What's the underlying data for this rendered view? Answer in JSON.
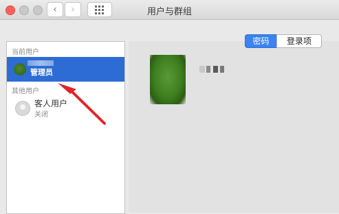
{
  "window": {
    "title": "用户与群组"
  },
  "toolbar": {
    "back_icon": "chevron-left-icon",
    "forward_icon": "chevron-right-icon",
    "grid_icon": "grid-icon"
  },
  "sidebar": {
    "current_section": "当前用户",
    "current_user": {
      "label": "管理员"
    },
    "other_section": "其他用户",
    "guest": {
      "name": "客人用户",
      "status": "关闭"
    }
  },
  "tabs": {
    "password": "密码",
    "login_items": "登录项",
    "selected": "密码"
  },
  "colors": {
    "selection": "#2e6cd5",
    "annotation_arrow": "#e0252a",
    "close_button": "#fc605c"
  }
}
